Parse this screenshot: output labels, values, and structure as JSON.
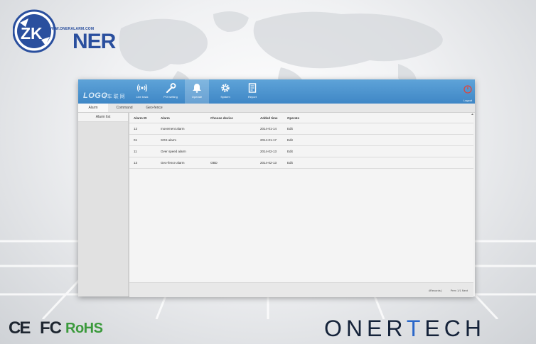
{
  "brand": {
    "url_text": "WWW.ONERALARM.COM",
    "logo_text": "ZK",
    "wordmark": "NER"
  },
  "app": {
    "logo_text": "LOGO",
    "logo_sub": "| 车 联 网",
    "nav": [
      {
        "label": "Live track",
        "icon": "signal-icon"
      },
      {
        "label": "POI setting",
        "icon": "wrench-icon"
      },
      {
        "label": "Operate",
        "icon": "bell-icon"
      },
      {
        "label": "System",
        "icon": "gear-icon"
      },
      {
        "label": "Report",
        "icon": "document-icon"
      }
    ],
    "nav_active": "Operate",
    "logout_label": "Logout",
    "tabs": [
      "Alarm",
      "Command",
      "Geo-fence"
    ],
    "tab_active": "Alarm",
    "sidebar": [
      "Alarm list"
    ],
    "table": {
      "headers": [
        "Alarm ID",
        "Alarm",
        "Choose device",
        "Added time",
        "Operate"
      ],
      "rows": [
        [
          "12",
          "movement alarm",
          "",
          "2014-01-14",
          "Edit"
        ],
        [
          "01",
          "SOS alarm",
          "",
          "2014-01-17",
          "Edit"
        ],
        [
          "11",
          "Over speed alarm",
          "",
          "2014-02-13",
          "Edit"
        ],
        [
          "13",
          "Geo-fence alarm",
          "OBD",
          "2014-02-13",
          "Edit"
        ]
      ]
    },
    "footer": {
      "records": "4Records |",
      "pager": "Prev  1/1  Next"
    }
  },
  "certs": {
    "ce": "CE",
    "fc": "FC",
    "rohs": "RoHS"
  },
  "company": {
    "part1": "ONER",
    "part2": "T",
    "part3": "ECH"
  }
}
